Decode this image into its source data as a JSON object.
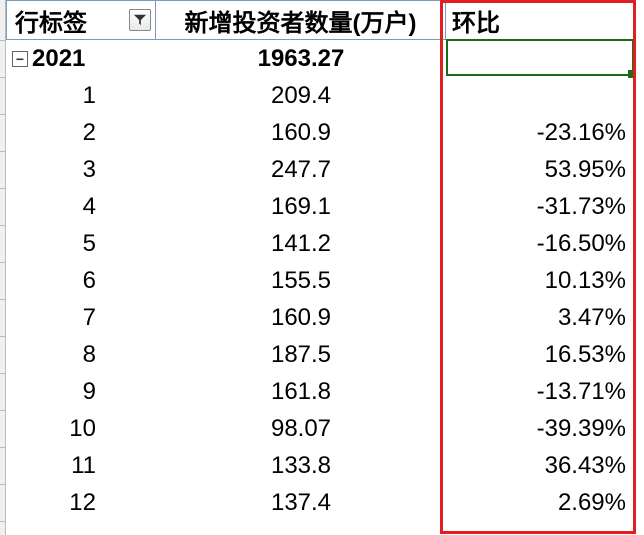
{
  "headers": {
    "row_label": "行标签",
    "new_investors": "新增投资者数量(万户)",
    "mom": "环比"
  },
  "summary": {
    "year": "2021",
    "total": "1963.27",
    "mom": ""
  },
  "rows": [
    {
      "month": "1",
      "value": "209.4",
      "mom": ""
    },
    {
      "month": "2",
      "value": "160.9",
      "mom": "-23.16%"
    },
    {
      "month": "3",
      "value": "247.7",
      "mom": "53.95%"
    },
    {
      "month": "4",
      "value": "169.1",
      "mom": "-31.73%"
    },
    {
      "month": "5",
      "value": "141.2",
      "mom": "-16.50%"
    },
    {
      "month": "6",
      "value": "155.5",
      "mom": "10.13%"
    },
    {
      "month": "7",
      "value": "160.9",
      "mom": "3.47%"
    },
    {
      "month": "8",
      "value": "187.5",
      "mom": "16.53%"
    },
    {
      "month": "9",
      "value": "161.8",
      "mom": "-13.71%"
    },
    {
      "month": "10",
      "value": "98.07",
      "mom": "-39.39%"
    },
    {
      "month": "11",
      "value": "133.8",
      "mom": "36.43%"
    },
    {
      "month": "12",
      "value": "137.4",
      "mom": "2.69%"
    }
  ],
  "chart_data": {
    "type": "table",
    "title": "新增投资者数量(万户) 2021",
    "categories": [
      "1",
      "2",
      "3",
      "4",
      "5",
      "6",
      "7",
      "8",
      "9",
      "10",
      "11",
      "12"
    ],
    "series": [
      {
        "name": "新增投资者数量(万户)",
        "values": [
          209.4,
          160.9,
          247.7,
          169.1,
          141.2,
          155.5,
          160.9,
          187.5,
          161.8,
          98.07,
          133.8,
          137.4
        ]
      },
      {
        "name": "环比",
        "values": [
          null,
          -23.16,
          53.95,
          -31.73,
          -16.5,
          10.13,
          3.47,
          16.53,
          -13.71,
          -39.39,
          36.43,
          2.69
        ]
      }
    ],
    "total": 1963.27
  }
}
